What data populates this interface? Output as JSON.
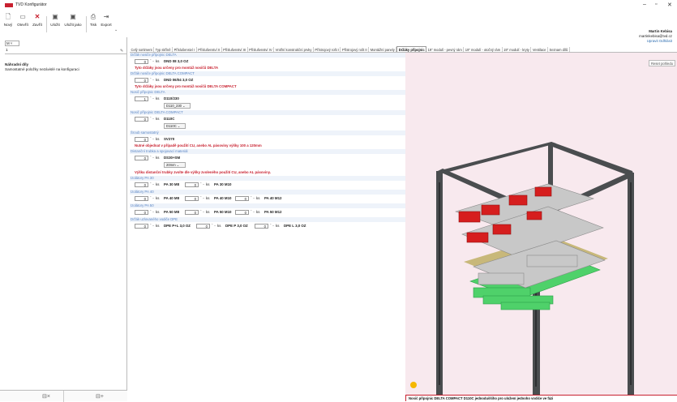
{
  "window": {
    "title": "TVD Konfigurátor",
    "controls": [
      "–",
      "▫",
      "✕"
    ]
  },
  "toolbar": {
    "buttons": [
      {
        "label": "Nový",
        "icon": "new-file-icon"
      },
      {
        "label": "Otevřít",
        "icon": "folder-icon"
      },
      {
        "label": "Zavřít",
        "icon": "close-icon"
      },
      {
        "label": "Uložit",
        "icon": "save-icon"
      },
      {
        "label": "Uložit jako",
        "icon": "save-as-icon"
      },
      {
        "label": "Tisk",
        "icon": "print-icon"
      },
      {
        "label": "Export",
        "icon": "export-icon"
      }
    ],
    "overflow": "⌄"
  },
  "user": {
    "name": "Martin Kebisa",
    "email": "martinkebisa@tvd.cz",
    "logout": "Upravit Odhlásit"
  },
  "left": {
    "combo_value": "M ˅",
    "project_number": "1",
    "selected_title": "Náhradní díly",
    "selected_sub": "Samostatné položky nezávislé na konfiguraci",
    "footer_left": "⊟×",
    "footer_right": "⊟+"
  },
  "tabs": [
    "Celý sortiment",
    "Typ skříně",
    "Příslušenství I",
    "Příslušenství II",
    "Příslušenství III",
    "Příslušenství IV",
    "Vnitřní konstrukční prvky",
    "Přístrojový rošt I",
    "Přístrojový rošt II",
    "Montážní panely",
    "Držáky přípojnic",
    "19\" modulí - pevný rám",
    "19\" modulí - otočný rám",
    "19\" modulí - kryty",
    "Ventilace",
    "Seznam dílů"
  ],
  "active_tab": 10,
  "form": {
    "s1": {
      "title": "Držák nosiče přípojnic DELTA",
      "qty": "0",
      "unit": "ks",
      "code": "DND 08 3,0 OZ",
      "warn": "Tyto držáky jsou určeny pro montáž nosičů DELTA"
    },
    "s2": {
      "title": "Držák nosiče přípojnic DELTA COMPACT",
      "qty": "0",
      "unit": "ks",
      "code": "DND 06/04 3,0 OZ",
      "warn": "Tyto držáky jsou určeny pro montáž nosičů DELTA COMPACT"
    },
    "s3": {
      "title": "Nosič přípojnic DELTA",
      "qty": "1",
      "unit": "ks",
      "code": "D110/230",
      "dd": "D110_230"
    },
    "s4": {
      "title": "Nosič přípojnic DELTA COMPACT",
      "qty": "0",
      "unit": "ks",
      "code": "D110C",
      "dd": "D110C"
    },
    "s5": {
      "title": "Šroub samostatný",
      "qty": "0",
      "unit": "ks",
      "code": "SV270",
      "warn": "Nutné objednat v případě použití CU, anebo AL pásoviny výšky 100 a 120mm"
    },
    "s6": {
      "title": "Distanční trubka a spojovací materiál",
      "qty": "0",
      "unit": "ks",
      "code": "DS30+SM",
      "dd": "20mm",
      "warn": "Výšku distanční trubky zvolte dle výšky zvoleného použití CU, anebo AL pásoviny."
    },
    "s7": {
      "title": "Izolátory PA 30",
      "items": [
        {
          "qty": "0",
          "code": "PA 30 M8"
        },
        {
          "qty": "0",
          "code": "PA 30 M10"
        }
      ]
    },
    "s8": {
      "title": "Izolátory PA 40",
      "items": [
        {
          "qty": "0",
          "code": "PA 40 M8"
        },
        {
          "qty": "0",
          "code": "PA 40 M10"
        },
        {
          "qty": "0",
          "code": "PA 40 M12"
        }
      ]
    },
    "s9": {
      "title": "Izolátory PA 50",
      "items": [
        {
          "qty": "0",
          "code": "PA 50 M8"
        },
        {
          "qty": "0",
          "code": "PA 50 M10"
        },
        {
          "qty": "0",
          "code": "PA 50 M12"
        }
      ]
    },
    "s10": {
      "title": "Držák uzlovaného vodiče DPE",
      "items": [
        {
          "qty": "0",
          "code": "DPE P+L 3,0 OZ"
        },
        {
          "qty": "0",
          "code": "DPE P 3,0 OZ"
        },
        {
          "qty": "0",
          "code": "DPE L 3,0 OZ"
        }
      ]
    },
    "unit": "ks"
  },
  "view": {
    "reset_label": "Reset pohledu"
  },
  "status": "Nosič přípojnic DELTA COMPACT D110C jednoduššího pro uložení jednoho vodiče ve fázi",
  "colors": {
    "accent_red": "#c8202f",
    "section_bg": "#eef3fa",
    "section_text": "#5b86c5",
    "view_bg": "#f8e9ee",
    "frame": "#4a4d4f",
    "busbar": "#d61e1e",
    "rail": "#c8c8c8",
    "green_part": "#4fd16a"
  }
}
